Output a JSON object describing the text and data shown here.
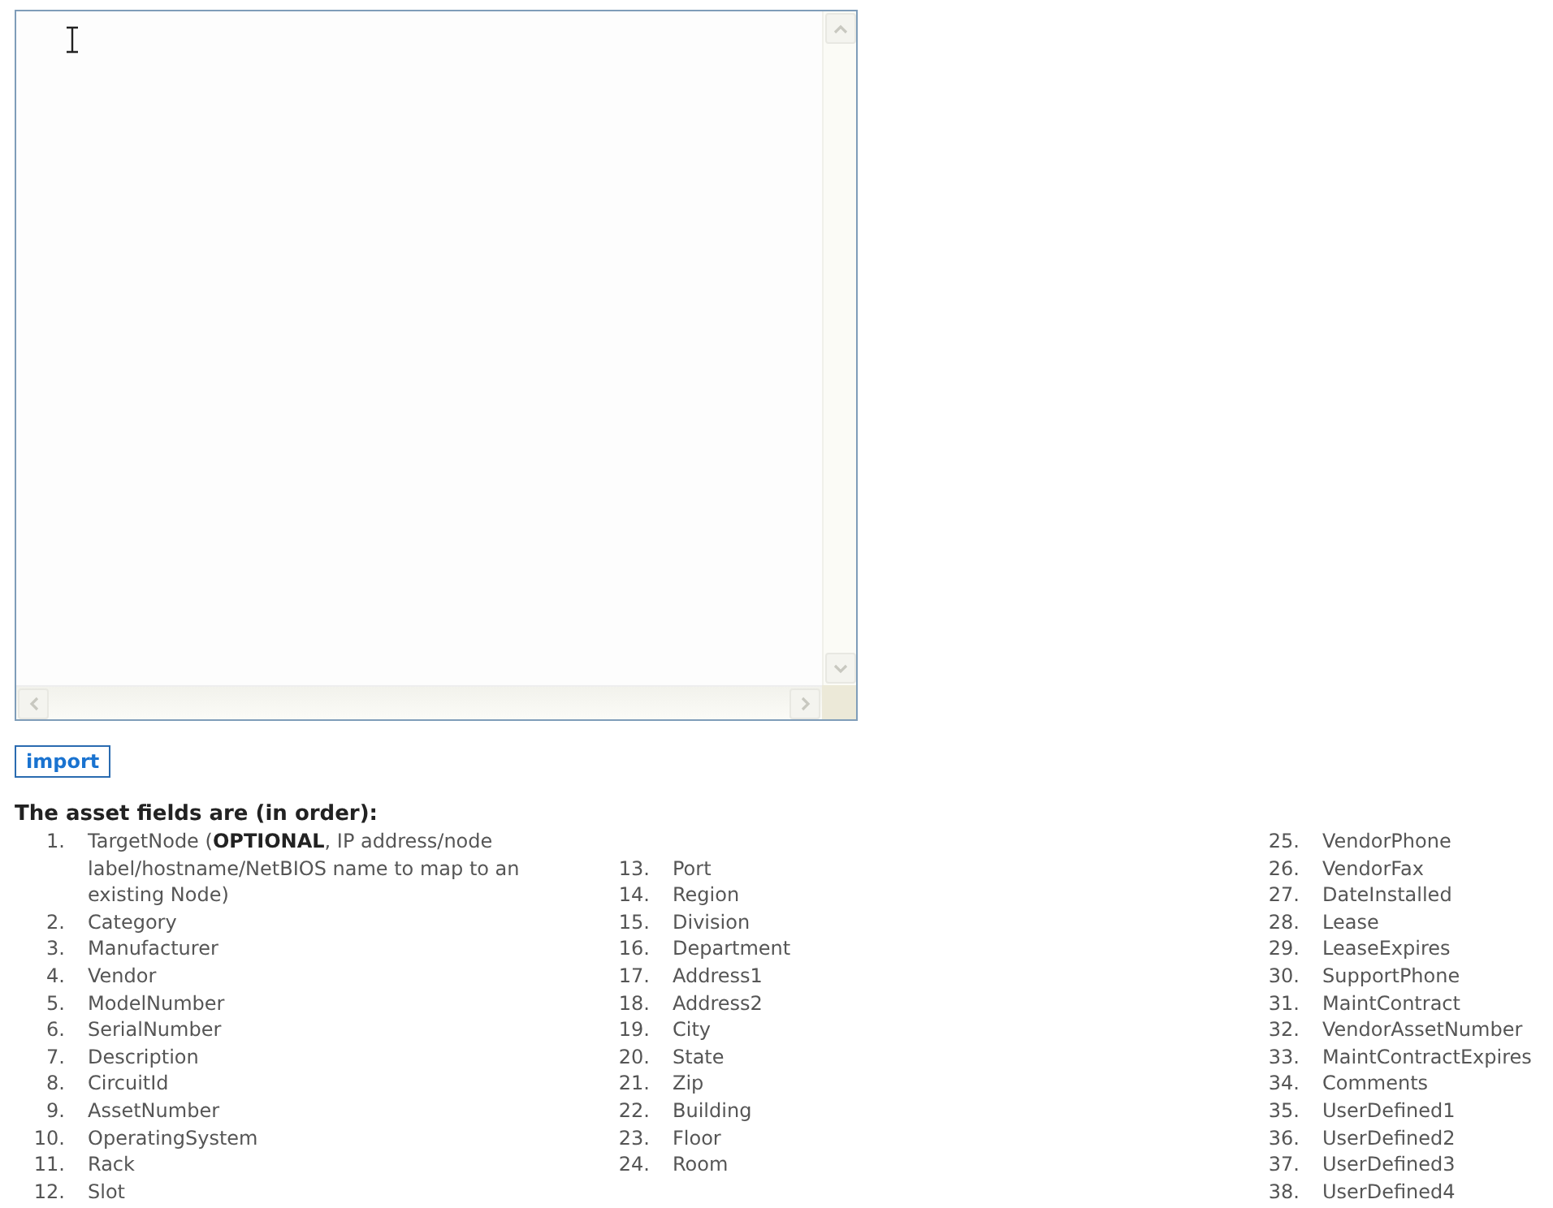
{
  "import_button": {
    "label": "import"
  },
  "heading": "The asset fields are (in order):",
  "field_columns": [
    {
      "items": [
        {
          "number": "1.",
          "text": "TargetNode (**OPTIONAL**, IP address/node label/hostname/NetBIOS name to map to an existing Node)"
        },
        {
          "number": "2.",
          "text": "Category"
        },
        {
          "number": "3.",
          "text": "Manufacturer"
        },
        {
          "number": "4.",
          "text": "Vendor"
        },
        {
          "number": "5.",
          "text": "ModelNumber"
        },
        {
          "number": "6.",
          "text": "SerialNumber"
        },
        {
          "number": "7.",
          "text": "Description"
        },
        {
          "number": "8.",
          "text": "CircuitId"
        },
        {
          "number": "9.",
          "text": "AssetNumber"
        },
        {
          "number": "10.",
          "text": "OperatingSystem"
        },
        {
          "number": "11.",
          "text": "Rack"
        },
        {
          "number": "12.",
          "text": "Slot"
        }
      ]
    },
    {
      "items": [
        {
          "number": "13.",
          "text": "Port"
        },
        {
          "number": "14.",
          "text": "Region"
        },
        {
          "number": "15.",
          "text": "Division"
        },
        {
          "number": "16.",
          "text": "Department"
        },
        {
          "number": "17.",
          "text": "Address1"
        },
        {
          "number": "18.",
          "text": "Address2"
        },
        {
          "number": "19.",
          "text": "City"
        },
        {
          "number": "20.",
          "text": "State"
        },
        {
          "number": "21.",
          "text": "Zip"
        },
        {
          "number": "22.",
          "text": "Building"
        },
        {
          "number": "23.",
          "text": "Floor"
        },
        {
          "number": "24.",
          "text": "Room"
        }
      ]
    },
    {
      "items": [
        {
          "number": "25.",
          "text": "VendorPhone"
        },
        {
          "number": "26.",
          "text": "VendorFax"
        },
        {
          "number": "27.",
          "text": "DateInstalled"
        },
        {
          "number": "28.",
          "text": "Lease"
        },
        {
          "number": "29.",
          "text": "LeaseExpires"
        },
        {
          "number": "30.",
          "text": "SupportPhone"
        },
        {
          "number": "31.",
          "text": "MaintContract"
        },
        {
          "number": "32.",
          "text": "VendorAssetNumber"
        },
        {
          "number": "33.",
          "text": "MaintContractExpires"
        },
        {
          "number": "34.",
          "text": "Comments"
        },
        {
          "number": "35.",
          "text": "UserDefined1"
        },
        {
          "number": "36.",
          "text": "UserDefined2"
        },
        {
          "number": "37.",
          "text": "UserDefined3"
        },
        {
          "number": "38.",
          "text": "UserDefined4"
        }
      ]
    }
  ]
}
